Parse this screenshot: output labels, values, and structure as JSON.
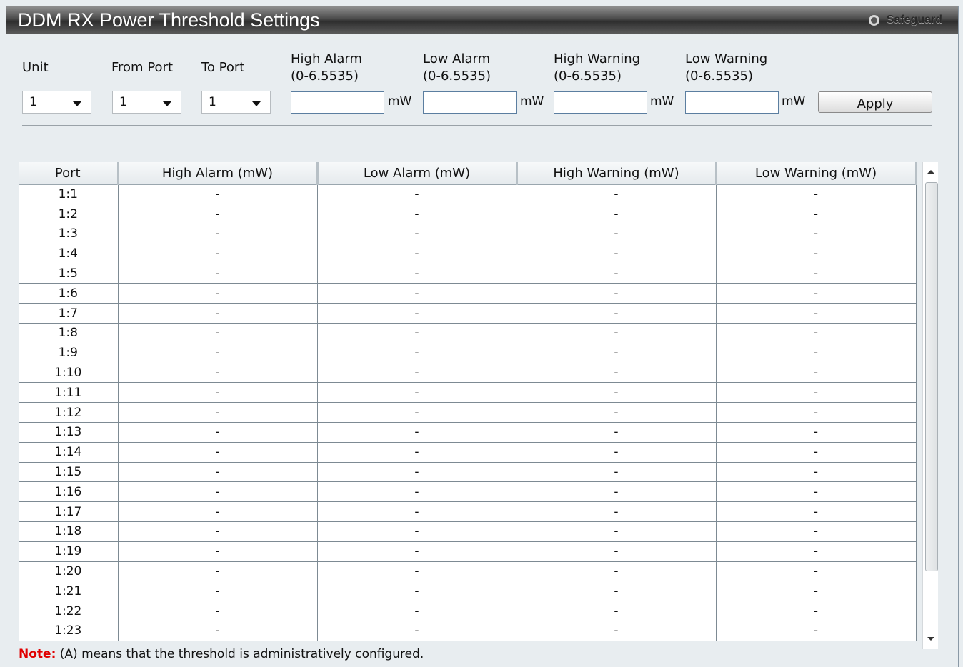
{
  "panel": {
    "title": "DDM RX Power Threshold Settings",
    "safeguard_label": "Safeguard"
  },
  "form": {
    "unit_label": "Unit",
    "from_port_label": "From Port",
    "to_port_label": "To Port",
    "high_alarm_label": "High Alarm",
    "high_alarm_range": "(0-6.5535)",
    "low_alarm_label": "Low Alarm",
    "low_alarm_range": "(0-6.5535)",
    "high_warning_label": "High Warning",
    "high_warning_range": "(0-6.5535)",
    "low_warning_label": "Low Warning",
    "low_warning_range": "(0-6.5535)",
    "unit_value": "1",
    "from_port_value": "1",
    "to_port_value": "1",
    "high_alarm_value": "",
    "low_alarm_value": "",
    "high_warning_value": "",
    "low_warning_value": "",
    "unit_suffix": "mW",
    "apply_label": "Apply"
  },
  "table": {
    "headers": [
      "Port",
      "High Alarm (mW)",
      "Low Alarm (mW)",
      "High Warning (mW)",
      "Low Warning (mW)"
    ],
    "rows": [
      [
        "1:1",
        "-",
        "-",
        "-",
        "-"
      ],
      [
        "1:2",
        "-",
        "-",
        "-",
        "-"
      ],
      [
        "1:3",
        "-",
        "-",
        "-",
        "-"
      ],
      [
        "1:4",
        "-",
        "-",
        "-",
        "-"
      ],
      [
        "1:5",
        "-",
        "-",
        "-",
        "-"
      ],
      [
        "1:6",
        "-",
        "-",
        "-",
        "-"
      ],
      [
        "1:7",
        "-",
        "-",
        "-",
        "-"
      ],
      [
        "1:8",
        "-",
        "-",
        "-",
        "-"
      ],
      [
        "1:9",
        "-",
        "-",
        "-",
        "-"
      ],
      [
        "1:10",
        "-",
        "-",
        "-",
        "-"
      ],
      [
        "1:11",
        "-",
        "-",
        "-",
        "-"
      ],
      [
        "1:12",
        "-",
        "-",
        "-",
        "-"
      ],
      [
        "1:13",
        "-",
        "-",
        "-",
        "-"
      ],
      [
        "1:14",
        "-",
        "-",
        "-",
        "-"
      ],
      [
        "1:15",
        "-",
        "-",
        "-",
        "-"
      ],
      [
        "1:16",
        "-",
        "-",
        "-",
        "-"
      ],
      [
        "1:17",
        "-",
        "-",
        "-",
        "-"
      ],
      [
        "1:18",
        "-",
        "-",
        "-",
        "-"
      ],
      [
        "1:19",
        "-",
        "-",
        "-",
        "-"
      ],
      [
        "1:20",
        "-",
        "-",
        "-",
        "-"
      ],
      [
        "1:21",
        "-",
        "-",
        "-",
        "-"
      ],
      [
        "1:22",
        "-",
        "-",
        "-",
        "-"
      ],
      [
        "1:23",
        "-",
        "-",
        "-",
        "-"
      ]
    ]
  },
  "note": {
    "label": "Note:",
    "text": " (A) means that the threshold is administratively configured."
  },
  "colors": {
    "title_bar": "#3a3a3a",
    "background": "#e8edf0",
    "note_label": "#e00000"
  }
}
